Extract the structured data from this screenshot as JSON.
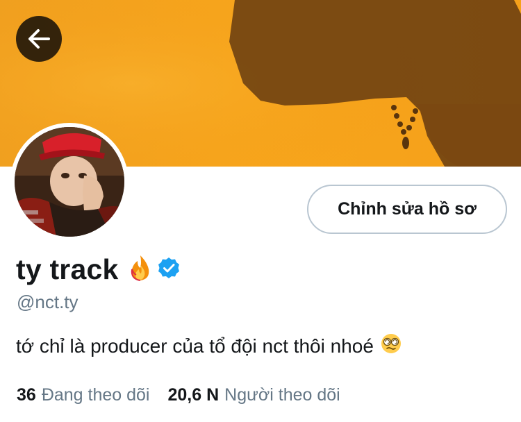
{
  "profile": {
    "display_name": "ty track",
    "name_emoji_icon": "fire-icon",
    "verified_icon": "verified-badge-icon",
    "handle": "@nct.ty",
    "bio": "tớ chỉ là producer của tổ đội nct thôi nhoé",
    "bio_emoji_icon": "dizzy-face-emoji-icon"
  },
  "actions": {
    "edit_profile_label": "Chỉnh sửa hồ sơ",
    "back_icon": "back-arrow-icon"
  },
  "stats": {
    "following_count": "36",
    "following_label": "Đang theo dõi",
    "followers_count": "20,6 N",
    "followers_label": "Người theo dõi"
  },
  "colors": {
    "banner": "#f6a11a",
    "verified": "#1da1f2",
    "secondary_text": "#657786",
    "button_border": "#b9c6d1"
  }
}
